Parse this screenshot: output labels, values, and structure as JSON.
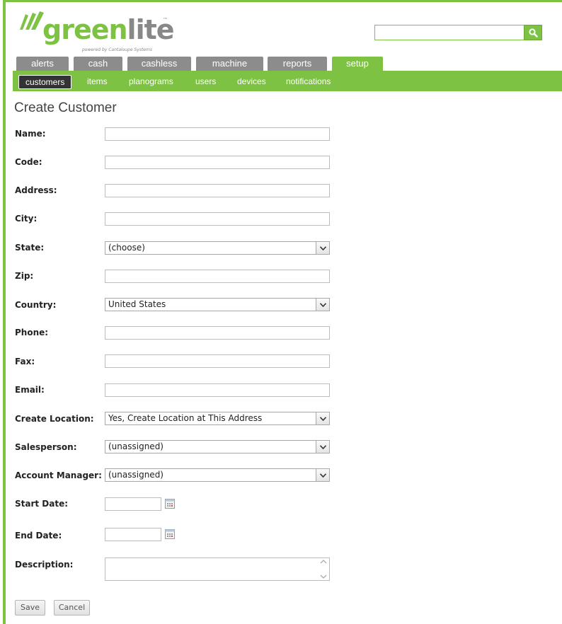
{
  "logo": {
    "text_green": "green",
    "text_grey": "lite",
    "trademark": "™",
    "tagline": "powered by Cantaloupe Systems"
  },
  "search": {
    "value": "",
    "placeholder": "",
    "icon": "search-icon"
  },
  "tabs": [
    {
      "label": "alerts"
    },
    {
      "label": "cash"
    },
    {
      "label": "cashless"
    },
    {
      "label": "machine"
    },
    {
      "label": "reports"
    },
    {
      "label": "setup",
      "active": true
    }
  ],
  "subnav": [
    {
      "label": "customers",
      "active": true
    },
    {
      "label": "items"
    },
    {
      "label": "planograms"
    },
    {
      "label": "users"
    },
    {
      "label": "devices"
    },
    {
      "label": "notifications"
    }
  ],
  "page_title": "Create Customer",
  "form": {
    "name": {
      "label": "Name:",
      "value": ""
    },
    "code": {
      "label": "Code:",
      "value": ""
    },
    "address": {
      "label": "Address:",
      "value": ""
    },
    "city": {
      "label": "City:",
      "value": ""
    },
    "state": {
      "label": "State:",
      "selected": "(choose)"
    },
    "zip": {
      "label": "Zip:",
      "value": ""
    },
    "country": {
      "label": "Country:",
      "selected": "United States"
    },
    "phone": {
      "label": "Phone:",
      "value": ""
    },
    "fax": {
      "label": "Fax:",
      "value": ""
    },
    "email": {
      "label": "Email:",
      "value": ""
    },
    "create_location": {
      "label": "Create Location:",
      "selected": "Yes, Create Location at This Address"
    },
    "salesperson": {
      "label": "Salesperson:",
      "selected": "(unassigned)"
    },
    "account_manager": {
      "label": "Account Manager:",
      "selected": "(unassigned)"
    },
    "start_date": {
      "label": "Start Date:",
      "value": ""
    },
    "end_date": {
      "label": "End Date:",
      "value": ""
    },
    "description": {
      "label": "Description:",
      "value": ""
    }
  },
  "buttons": {
    "save": "Save",
    "cancel": "Cancel"
  },
  "colors": {
    "brand_green": "#7dc242",
    "tab_grey": "#8c8c8c",
    "active_subnav": "#333333"
  }
}
